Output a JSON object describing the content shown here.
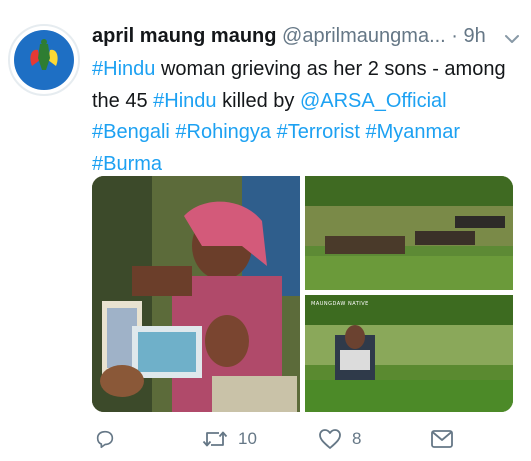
{
  "tweet": {
    "author_name": "april maung maung",
    "handle": "@aprilmaungma...",
    "separator": "·",
    "time": "9h",
    "text_segments": [
      {
        "text": "#Hindu",
        "link": true
      },
      {
        "text": " woman grieving as her 2 sons  - among the 45 ",
        "link": false
      },
      {
        "text": "#Hindu",
        "link": true
      },
      {
        "text": " killed by ",
        "link": false
      },
      {
        "text": "@ARSA_Official",
        "link": true
      },
      {
        "text": " ",
        "link": false
      },
      {
        "text": "#Bengali",
        "link": true
      },
      {
        "text": " ",
        "link": false
      },
      {
        "text": "#Rohingya",
        "link": true
      },
      {
        "text": " ",
        "link": false
      },
      {
        "text": "#Terrorist",
        "link": true
      },
      {
        "text": " ",
        "link": false
      },
      {
        "text": "#Myanmar",
        "link": true
      },
      {
        "text": " ",
        "link": false
      },
      {
        "text": "#Burma",
        "link": true
      }
    ]
  },
  "media": {
    "photo_1_watermark": "",
    "photo_3_watermark": "MAUNGDAW NATIVE"
  },
  "actions": {
    "reply_count": "",
    "retweet_count": "10",
    "like_count": "8"
  },
  "colors": {
    "link": "#1da1f2",
    "secondary_text": "#657786",
    "primary_text": "#14171a",
    "avatar_blue": "#1e6fc4"
  },
  "icons": [
    "chevron-down-icon",
    "reply-icon",
    "retweet-icon",
    "like-icon",
    "direct-message-icon"
  ]
}
